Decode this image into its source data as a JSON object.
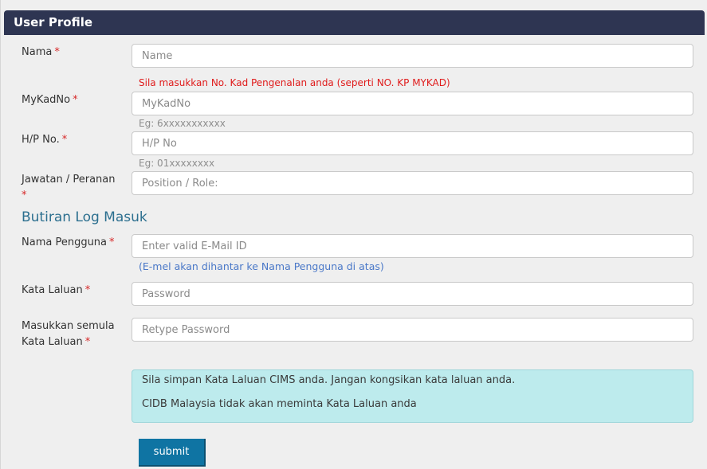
{
  "header": {
    "title": "User Profile"
  },
  "required_marker": "*",
  "fields": {
    "nama": {
      "label": "Nama",
      "placeholder": "Name",
      "value": ""
    },
    "mykad": {
      "label": "MyKadNo",
      "placeholder": "MyKadNo",
      "value": "",
      "error": "Sila masukkan No. Kad Pengenalan anda (seperti NO. KP MYKAD)",
      "hint": "Eg: 6xxxxxxxxxxx"
    },
    "hp": {
      "label": "H/P No.",
      "placeholder": "H/P No",
      "value": "",
      "hint": "Eg: 01xxxxxxxx"
    },
    "jawatan": {
      "label": "Jawatan / Peranan",
      "placeholder": "Position / Role:",
      "value": ""
    }
  },
  "login_section": {
    "title": "Butiran Log Masuk",
    "username": {
      "label": "Nama Pengguna",
      "placeholder": "Enter valid E-Mail ID",
      "value": "",
      "note": "(E-mel akan dihantar ke Nama Pengguna di atas)"
    },
    "password": {
      "label": "Kata Laluan",
      "placeholder": "Password",
      "value": ""
    },
    "retype": {
      "label_line1": "Masukkan semula",
      "label_line2": "Kata Laluan",
      "placeholder": "Retype Password",
      "value": ""
    }
  },
  "notice": {
    "line1": "Sila simpan Kata Laluan CIMS anda. Jangan kongsikan kata laluan anda.",
    "line2": "CIDB Malaysia tidak akan meminta Kata Laluan anda"
  },
  "submit_label": "submit",
  "colors": {
    "header_bg": "#2e3552",
    "required": "#d62828",
    "error": "#e01b1b",
    "section_title": "#2c6f8f",
    "note_link": "#4a78c8",
    "notice_bg": "#bdebed",
    "submit_bg": "#0f74a3"
  }
}
